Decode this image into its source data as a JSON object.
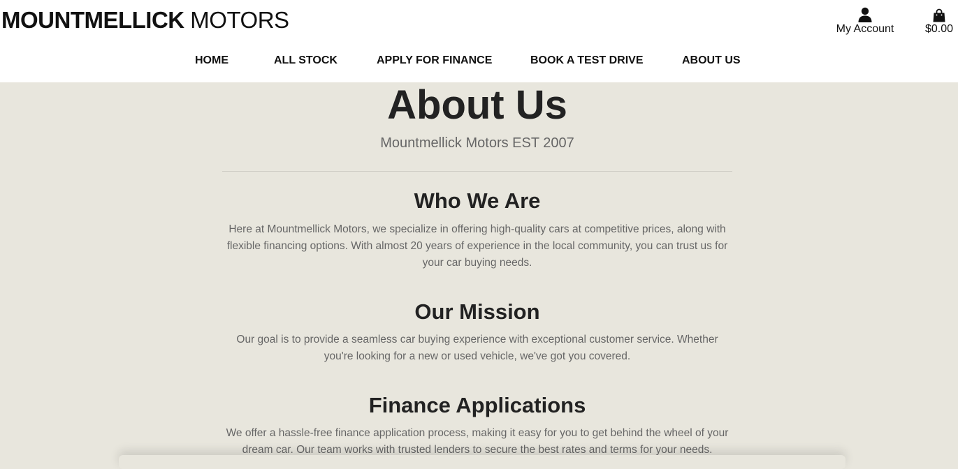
{
  "header": {
    "brand_bold": "MOUNTMELLICK",
    "brand_light": " MOTORS",
    "account_label": "My Account",
    "account_icon": "user-icon",
    "bag_total": "$0.00",
    "bag_icon": "shopping-bag-icon"
  },
  "nav": {
    "items": [
      "HOME",
      "ALL STOCK",
      "APPLY FOR FINANCE",
      "BOOK A TEST DRIVE",
      "ABOUT US"
    ]
  },
  "main": {
    "title": "About Us",
    "subtitle": "Mountmellick Motors EST 2007",
    "sections": [
      {
        "heading": "Who We Are",
        "text": "Here at Mountmellick Motors, we specialize in offering high-quality cars at competitive prices, along with flexible financing options. With almost 20 years of experience in the local community, you can trust us for your car buying needs."
      },
      {
        "heading": "Our Mission",
        "text": "Our goal is to provide a seamless car buying experience with exceptional customer service. Whether you're looking for a new or used vehicle, we've got you covered."
      },
      {
        "heading": "Finance Applications",
        "text": "We offer a hassle-free finance application process, making it easy for you to get behind the wheel of your dream car. Our team works with trusted lenders to secure the best rates and terms for your needs."
      }
    ]
  },
  "colors": {
    "page_background": "#e8e6dd",
    "header_background": "#ffffff",
    "heading_text": "#222222",
    "body_text": "#666666"
  }
}
